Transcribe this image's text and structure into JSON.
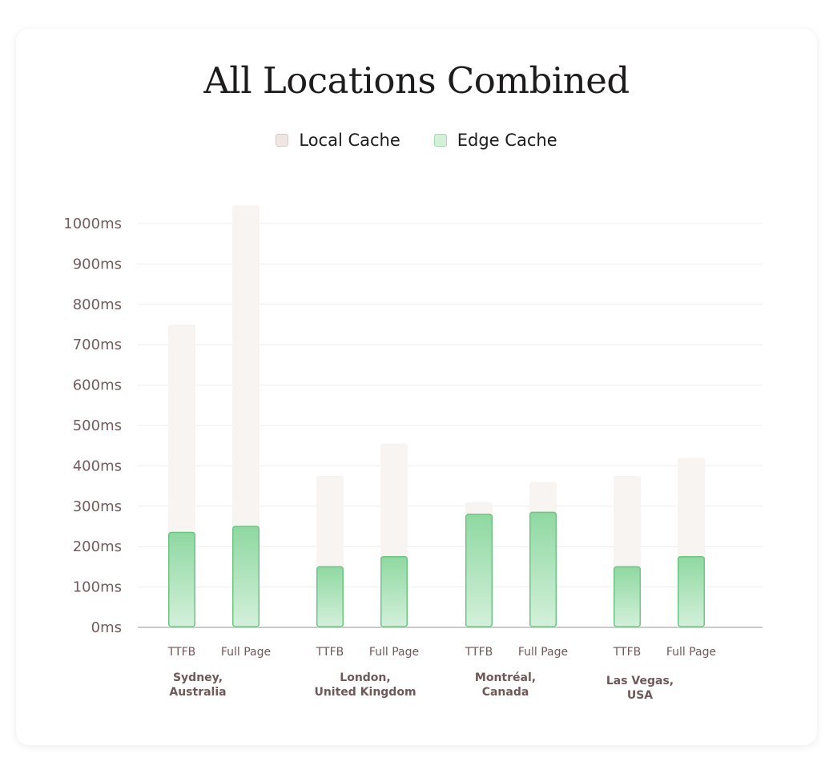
{
  "colors": {
    "local_cache": "#f8f4f1",
    "edge_cache_top": "#8fd8a1",
    "edge_cache_bottom": "#d3f0da",
    "edge_cache_stroke": "#6cc583",
    "grid": "#eeeeee",
    "axis": "#c9c9c9"
  },
  "chart_data": {
    "type": "bar",
    "title": "All Locations Combined",
    "legend": {
      "placement": "top-center",
      "items": [
        {
          "name": "Local Cache",
          "swatch": "local"
        },
        {
          "name": "Edge Cache",
          "swatch": "edge"
        }
      ]
    },
    "ylim": [
      0,
      1000
    ],
    "yticks": [
      0,
      100,
      200,
      300,
      400,
      500,
      600,
      700,
      800,
      900,
      1000
    ],
    "ytick_labels": [
      "0ms",
      "100ms",
      "200ms",
      "300ms",
      "400ms",
      "500ms",
      "600ms",
      "700ms",
      "800ms",
      "900ms",
      "1000ms"
    ],
    "grid": true,
    "groups": [
      {
        "label": [
          "Sydney,",
          "Australia"
        ],
        "bars": [
          {
            "label": "TTFB",
            "local": 750,
            "edge": 235
          },
          {
            "label": "Full Page",
            "local": 1045,
            "edge": 250
          }
        ]
      },
      {
        "label": [
          "London,",
          "United Kingdom"
        ],
        "bars": [
          {
            "label": "TTFB",
            "local": 375,
            "edge": 150
          },
          {
            "label": "Full Page",
            "local": 455,
            "edge": 175
          }
        ]
      },
      {
        "label": [
          "Montréal,",
          "Canada"
        ],
        "bars": [
          {
            "label": "TTFB",
            "local": 310,
            "edge": 280
          },
          {
            "label": "Full Page",
            "local": 360,
            "edge": 285
          }
        ]
      },
      {
        "label": [
          "Las Vegas,",
          "USA"
        ],
        "bars": [
          {
            "label": "TTFB",
            "local": 375,
            "edge": 150
          },
          {
            "label": "Full Page",
            "local": 420,
            "edge": 175
          }
        ]
      }
    ],
    "series": [
      {
        "name": "Local Cache"
      },
      {
        "name": "Edge Cache"
      }
    ]
  }
}
